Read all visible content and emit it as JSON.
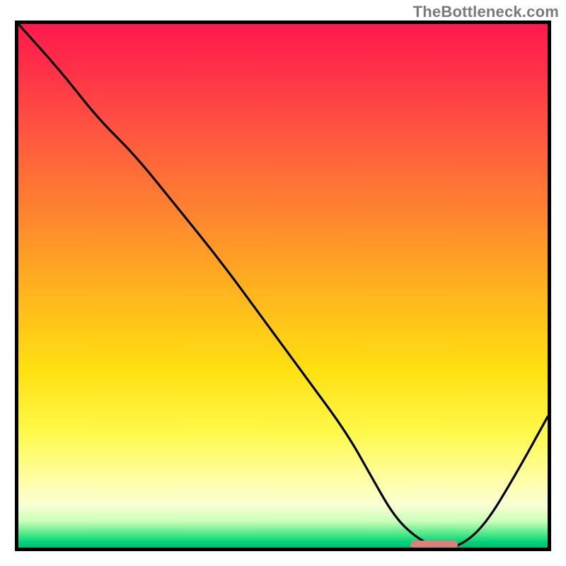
{
  "watermark": "TheBottleneck.com",
  "chart_data": {
    "type": "line",
    "title": "",
    "xlabel": "",
    "ylabel": "",
    "xlim": [
      0,
      100
    ],
    "ylim": [
      0,
      100
    ],
    "grid": false,
    "legend": false,
    "series": [
      {
        "name": "bottleneck-curve",
        "x": [
          0,
          8,
          15,
          22,
          30,
          38,
          46,
          54,
          62,
          67,
          71,
          75,
          79,
          83,
          88,
          94,
          100
        ],
        "values": [
          100,
          91,
          82,
          75,
          65,
          55,
          44,
          33,
          22,
          13,
          6,
          2,
          0,
          0,
          4,
          14,
          25
        ]
      }
    ],
    "optimal_zone": {
      "x_start": 74,
      "x_end": 83,
      "y": 0
    },
    "gradient_stops": [
      {
        "pct": 0,
        "color": "#ff1a4d"
      },
      {
        "pct": 38,
        "color": "#ff8a2d"
      },
      {
        "pct": 66,
        "color": "#ffe011"
      },
      {
        "pct": 88,
        "color": "#ffffb0"
      },
      {
        "pct": 97,
        "color": "#47e887"
      },
      {
        "pct": 100,
        "color": "#00bc70"
      }
    ]
  }
}
